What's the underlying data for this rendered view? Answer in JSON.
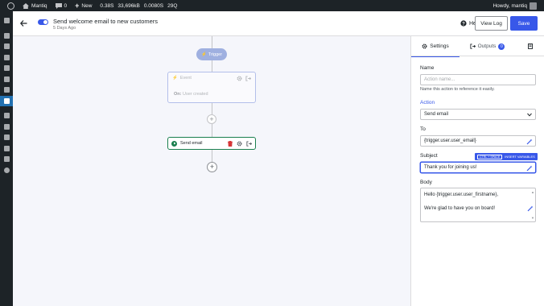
{
  "adminbar": {
    "site_name": "Mantiq",
    "comments_count": "0",
    "new_label": "New",
    "stats": [
      "0.38S",
      "33,696kB",
      "0.0080S",
      "29Q"
    ],
    "greeting": "Howdy, mantiq"
  },
  "header": {
    "title": "Send welcome email to new customers",
    "subtitle": "5 Days Ago",
    "help_label": "Help",
    "view_log_label": "View Log",
    "save_label": "Save",
    "toggle_on": true
  },
  "canvas": {
    "trigger_label": "Trigger",
    "event_card": {
      "title": "Event",
      "on_prefix": "On:",
      "on_value": "User created"
    },
    "action_card": {
      "title": "Send email"
    }
  },
  "sidebar": {
    "tabs": [
      {
        "label": "Settings",
        "icon": "gear-icon"
      },
      {
        "label": "Outputs",
        "icon": "output-icon",
        "badge": "0"
      },
      {
        "label": "",
        "icon": "document-icon"
      }
    ],
    "name": {
      "label": "Name",
      "placeholder": "Action name...",
      "help": "Name this action to reference it easily."
    },
    "action": {
      "label": "Action",
      "value": "Send email"
    },
    "to": {
      "label": "To",
      "value": "{trigger.user.user_email}"
    },
    "subject": {
      "label": "Subject",
      "value": "Thank you for joining us!",
      "tooltip_key": "CTRL + SPACE",
      "tooltip_text": "INSERT VARIABLES"
    },
    "body": {
      "label": "Body",
      "line1": "Hello {trigger.user.user_firstname},",
      "line2": "We're glad to have you on board!"
    }
  },
  "colors": {
    "accent": "#3858e9",
    "success": "#1a7f4e",
    "admin_bar": "#1d2327",
    "canvas_bg": "#f5f6fb"
  }
}
